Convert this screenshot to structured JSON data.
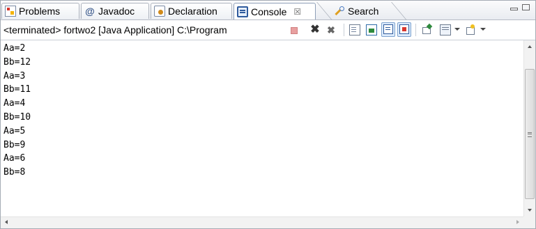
{
  "tabs": [
    {
      "label": "Problems",
      "icon": "problems-icon"
    },
    {
      "label": "Javadoc",
      "icon": "at-icon"
    },
    {
      "label": "Declaration",
      "icon": "declaration-icon"
    },
    {
      "label": "Console",
      "icon": "console-icon",
      "close": "☒"
    },
    {
      "label": "Search",
      "icon": "search-icon"
    }
  ],
  "toolbar": {
    "process_label": "<terminated> fortwo2 [Java Application] C:\\Program"
  },
  "console": {
    "lines": [
      "Aa=2",
      "Bb=12",
      "Aa=3",
      "Bb=11",
      "Aa=4",
      "Bb=10",
      "Aa=5",
      "Bb=9",
      "Aa=6",
      "Bb=8"
    ]
  }
}
